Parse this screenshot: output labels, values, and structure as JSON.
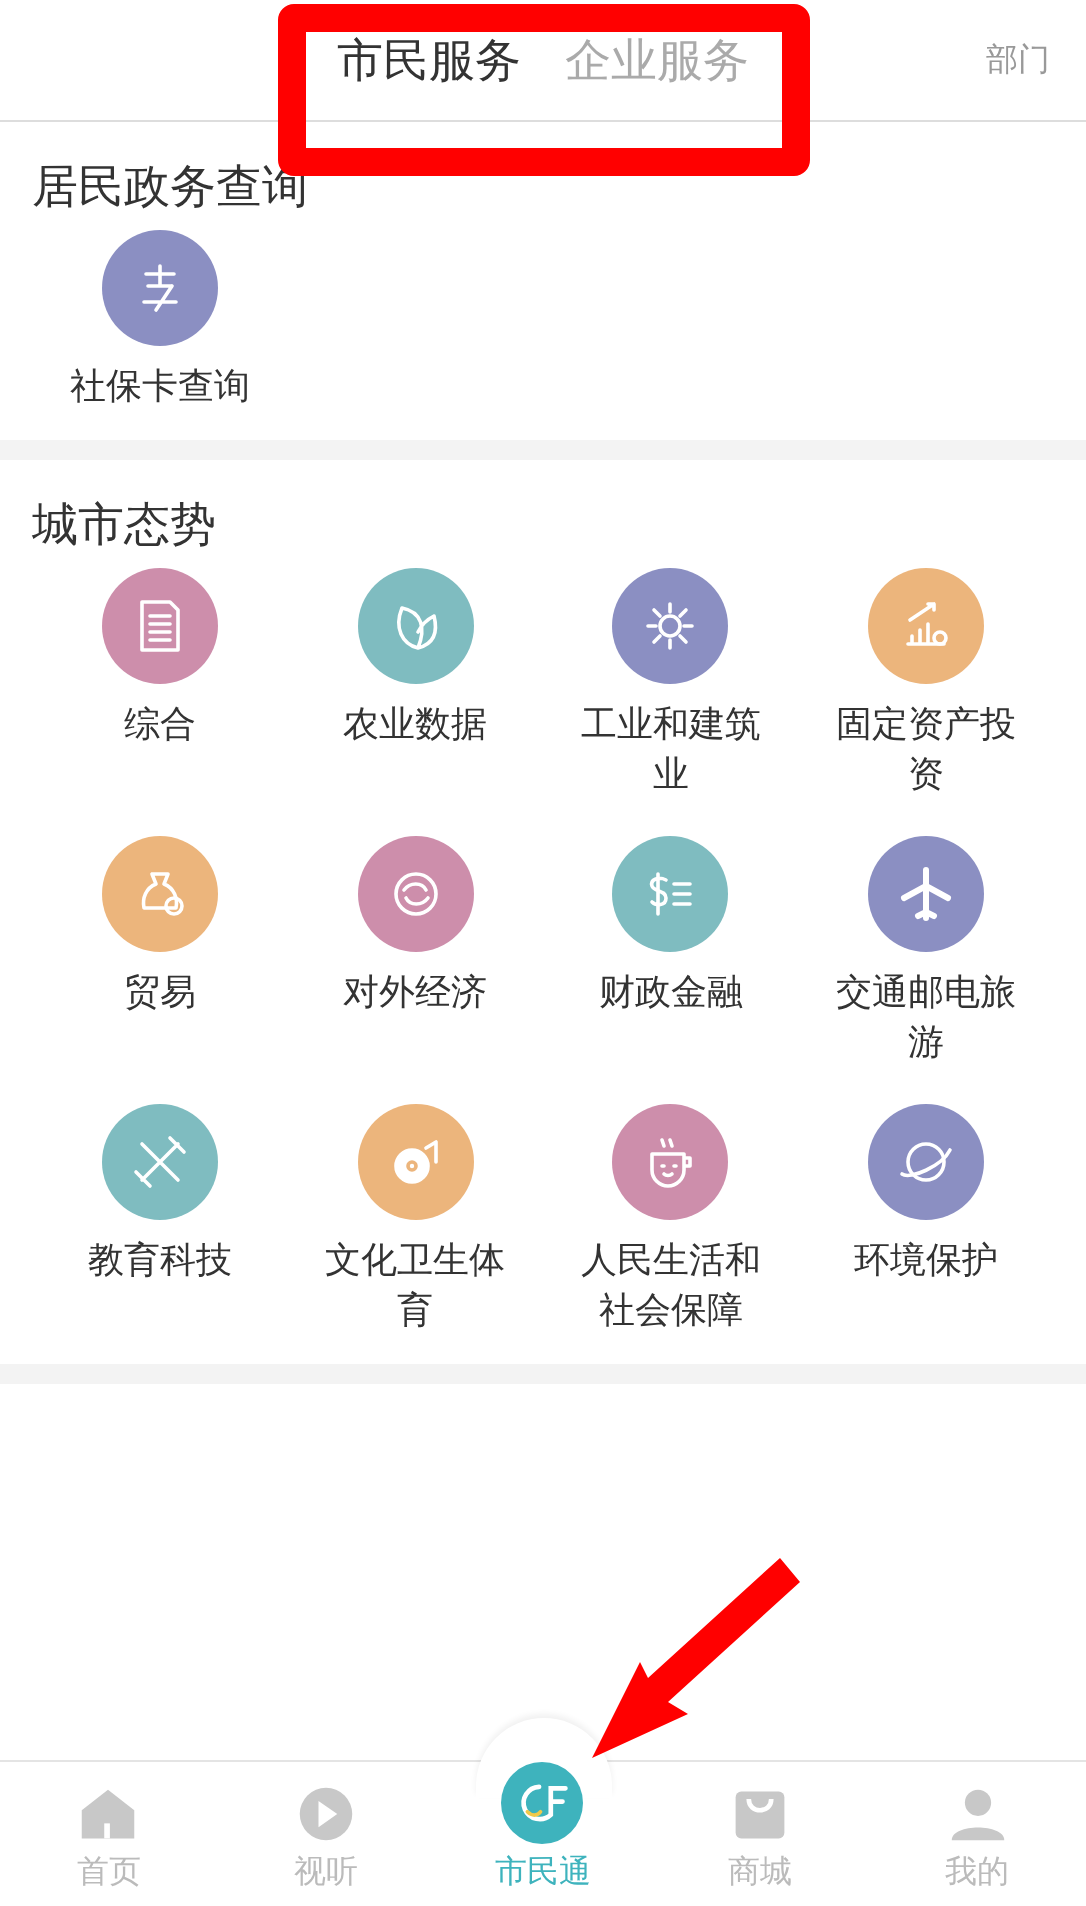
{
  "header": {
    "tabs": [
      {
        "label": "市民服务",
        "selected": true
      },
      {
        "label": "企业服务",
        "selected": false
      }
    ],
    "right_link": "部门"
  },
  "sections": [
    {
      "title": "居民政务查询",
      "items": [
        {
          "label": "社保卡查询",
          "color": "#8b8fc2"
        }
      ]
    },
    {
      "title": "城市态势",
      "items": [
        {
          "label": "综合",
          "color": "#cd8eab"
        },
        {
          "label": "农业数据",
          "color": "#7fbcc0"
        },
        {
          "label": "工业和建筑业",
          "color": "#8b8fc2"
        },
        {
          "label": "固定资产投资",
          "color": "#ecb57c"
        },
        {
          "label": "贸易",
          "color": "#ecb57c"
        },
        {
          "label": "对外经济",
          "color": "#cd8eab"
        },
        {
          "label": "财政金融",
          "color": "#7fbcc0"
        },
        {
          "label": "交通邮电旅游",
          "color": "#8b8fc2"
        },
        {
          "label": "教育科技",
          "color": "#7fbcc0"
        },
        {
          "label": "文化卫生体育",
          "color": "#ecb57c"
        },
        {
          "label": "人民生活和社会保障",
          "color": "#cd8eab"
        },
        {
          "label": "环境保护",
          "color": "#8b8fc2"
        }
      ]
    }
  ],
  "tab_bar": [
    {
      "label": "首页",
      "selected": false
    },
    {
      "label": "视听",
      "selected": false
    },
    {
      "label": "市民通",
      "selected": true
    },
    {
      "label": "商城",
      "selected": false
    },
    {
      "label": "我的",
      "selected": false
    }
  ]
}
